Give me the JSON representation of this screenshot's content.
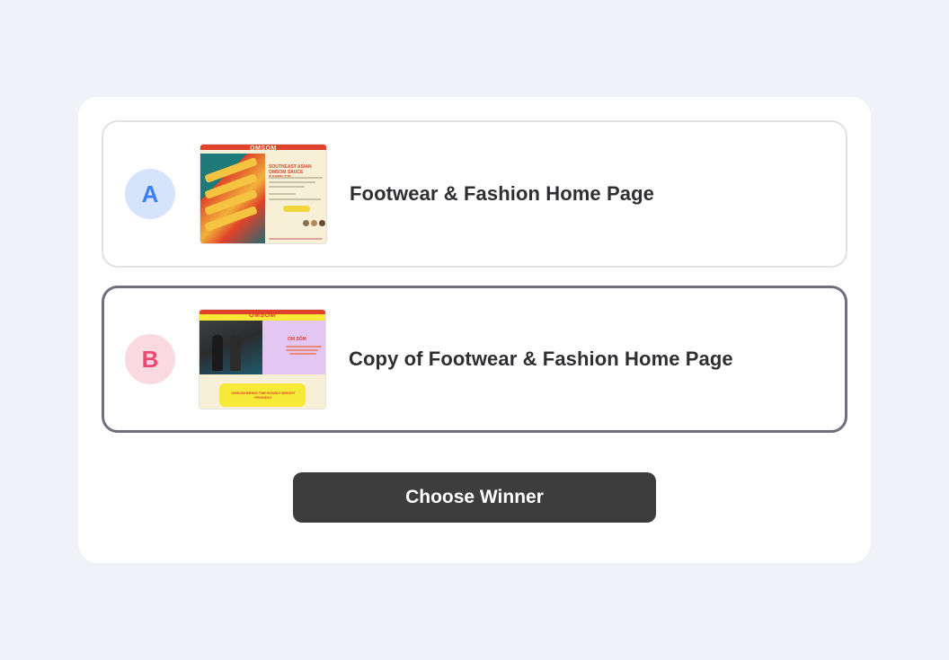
{
  "options": [
    {
      "badge": "A",
      "title": "Footwear & Fashion Home Page",
      "thumbnail": {
        "brand": "OMSOM",
        "heading": "SOUTHEAST ASIAN OMSOM SAUCE SAMPLER",
        "button": "ADD TO BASKET"
      }
    },
    {
      "badge": "B",
      "title": "Copy of Footwear & Fashion Home Page",
      "thumbnail": {
        "brand": "OMSOM",
        "heading": "OM SÔM",
        "banner": "OMSOM BRING THE ROWDY BRIGHT PROUDLY"
      }
    }
  ],
  "choose_button": "Choose Winner",
  "colors": {
    "badge_a_bg": "#d6e4fb",
    "badge_a_text": "#3b7ff0",
    "badge_b_bg": "#fbd9e1",
    "badge_b_text": "#ee4a70",
    "button_bg": "#3d3d3d",
    "selected_border": "#6f6f80"
  }
}
